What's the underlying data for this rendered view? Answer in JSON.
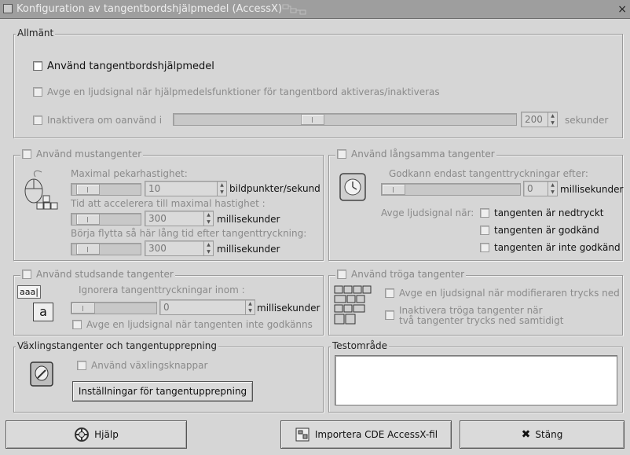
{
  "window": {
    "title": "Konfiguration av tangentbordshjälpmedel (AccessX)",
    "close_glyph": "×"
  },
  "general": {
    "legend": "Allmänt",
    "enable_label": "Använd tangentbordshjälpmedel",
    "enable_checked": false,
    "beep_label": "Avge en ljudsignal när hjälpmedelsfunktioner för tangentbord aktiveras/inaktiveras",
    "beep_checked": false,
    "disable_label": "Inaktivera om oanvänd i",
    "disable_checked": false,
    "timeout_value": "200",
    "timeout_unit": "sekunder",
    "timeout_level": 0.4
  },
  "mouse_keys": {
    "legend": "Använd mustangenter",
    "checked": false,
    "max_speed_label": "Maximal pekarhastighet:",
    "max_speed_value": "10",
    "max_speed_unit": "bildpunkter/sekund",
    "max_speed_level": 0.1,
    "accel_label": "Tid att accelerera till maximal hastighet :",
    "accel_value": "300",
    "accel_unit": "millisekunder",
    "accel_level": 0.1,
    "delay_label": "Börja flytta så här lång tid efter tangenttryckning:",
    "delay_value": "300",
    "delay_unit": "millisekunder",
    "delay_level": 0.1,
    "icon": "mouse-keys-icon"
  },
  "slow_keys": {
    "legend": "Använd långsamma tangenter",
    "checked": false,
    "accept_label": "Godkann endast tangenttryckningar efter:",
    "accept_value": "0",
    "accept_unit": "millisekunder",
    "accept_level": 0.0,
    "beep_when_label": "Avge ljudsignal när:",
    "options": [
      {
        "label": "tangenten är nedtryckt",
        "checked": false
      },
      {
        "label": "tangenten är godkänd",
        "checked": false
      },
      {
        "label": "tangenten är inte godkänd",
        "checked": false
      }
    ],
    "icon": "slow-keys-icon"
  },
  "bounce_keys": {
    "legend": "Använd studsande tangenter",
    "checked": false,
    "ignore_label": "Ignorera tangenttryckningar inom :",
    "ignore_value": "0",
    "ignore_unit": "millisekunder",
    "ignore_level": 0.0,
    "beep_label": "Avge en ljudsignal när tangenten inte godkänns",
    "beep_checked": false,
    "icon_text_1": "aaa|",
    "icon_text_2": "a"
  },
  "sticky_keys": {
    "legend": "Använd tröga tangenter",
    "checked": false,
    "beep_label": "Avge en ljudsignal när modifieraren trycks ned",
    "beep_checked": false,
    "disable_label_line1": "Inaktivera tröga tangenter när",
    "disable_label_line2": "två tangenter trycks ned samtidigt",
    "disable_checked": false,
    "icon": "sticky-keys-icon"
  },
  "toggle_repeat": {
    "legend": "Växlingstangenter och tangentupprepning",
    "toggle_label": "Använd växlingsknappar",
    "toggle_checked": false,
    "repeat_button": "Inställningar för tangentupprepning",
    "icon": "toggle-keys-icon"
  },
  "test_area": {
    "legend": "Testområde",
    "value": ""
  },
  "footer": {
    "help": "Hjälp",
    "import": "Importera CDE AccessX-fil",
    "close": "Stäng",
    "help_icon": "lifebuoy-icon",
    "import_icon": "import-icon",
    "close_icon": "x-icon"
  }
}
